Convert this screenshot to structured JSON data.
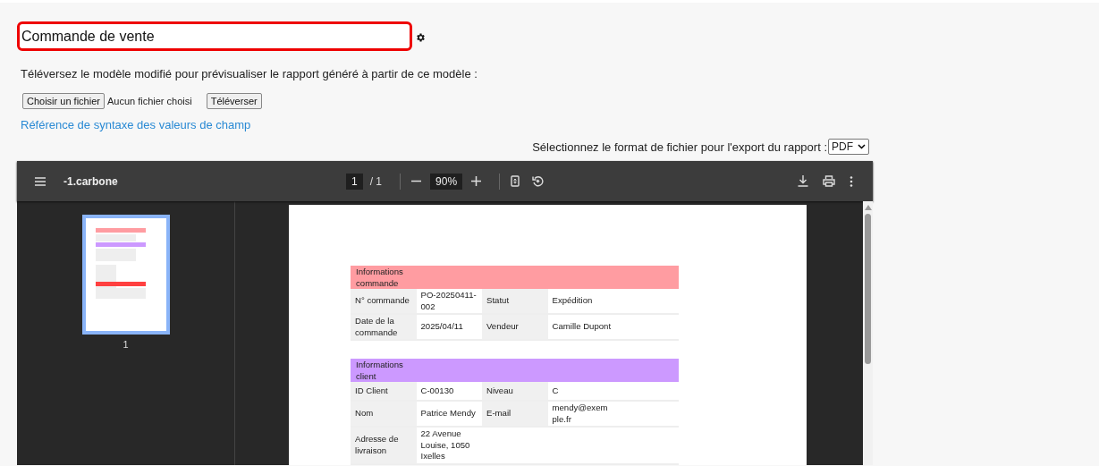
{
  "title_field": {
    "value": "Commande de vente"
  },
  "instructions": "Téléversez le modèle modifié pour prévisualiser le rapport généré à partir de ce modèle :",
  "file_picker": {
    "button": "Choisir un fichier",
    "status": "Aucun fichier choisi"
  },
  "upload_button": "Téléverser",
  "syntax_link": "Référence de syntaxe des valeurs de champ",
  "export": {
    "label": "Sélectionnez le format de fichier pour l'export du rapport :",
    "value": "PDF"
  },
  "viewer": {
    "file_name": "-1.carbone",
    "page": "1",
    "page_total": "/ 1",
    "zoom": "90%",
    "thumbnails": [
      {
        "label": "1",
        "selected": true
      }
    ],
    "document": {
      "sections": [
        {
          "title": "Informations commande",
          "color": "#ff9ca1",
          "rows": [
            [
              "N° commande",
              "PO-20250411-002",
              "Statut",
              "Expédition"
            ],
            [
              "Date de la commande",
              "2025/04/11",
              "Vendeur",
              "Camille Dupont"
            ]
          ]
        },
        {
          "title": "Informations client",
          "color": "#cc99ff",
          "rows": [
            [
              "ID Client",
              "C-00130",
              "Niveau",
              "C"
            ],
            [
              "Nom",
              "Patrice Mendy",
              "E-mail",
              "mendy@exemple.fr"
            ],
            [
              "Adresse de livraison",
              "22 Avenue Louise, 1050 Ixelles"
            ]
          ]
        }
      ]
    }
  }
}
